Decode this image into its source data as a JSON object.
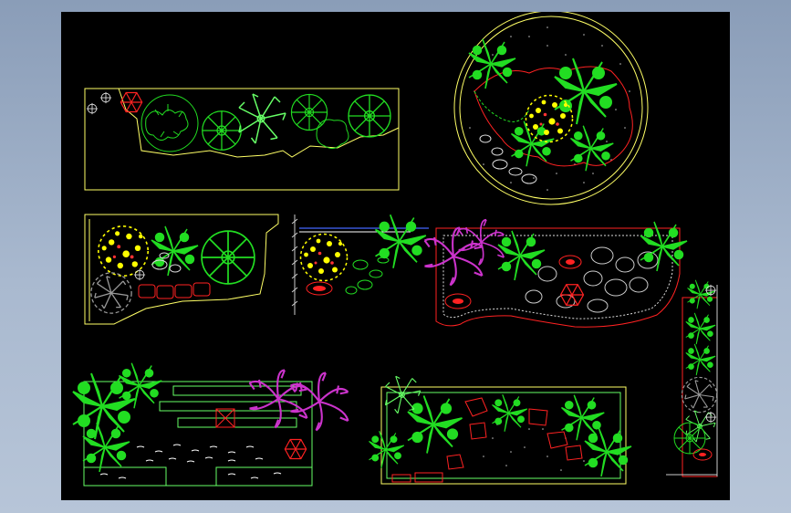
{
  "drawing": {
    "background": "#000000",
    "outer_background": "#9fb1c9",
    "palette": {
      "outline_yellow": "#ffff66",
      "paving_white": "#ffffff",
      "foliage_green": "#22dd22",
      "shrub_lightgreen": "#66ff66",
      "flower_yellow": "#ffff00",
      "ornamental_magenta": "#cc33cc",
      "edging_red": "#ff2222",
      "rock_gray": "#9a9a9a",
      "water_blue": "#4466ff"
    },
    "panels": [
      {
        "id": "linear-planter-top",
        "content": [
          "hexagon-lantern",
          "circle-trees",
          "ferns",
          "yellow-border"
        ]
      },
      {
        "id": "circular-garden",
        "content": [
          "palms",
          "flower-cluster",
          "gravel",
          "stepping-stones"
        ]
      },
      {
        "id": "corner-garden",
        "content": [
          "flower-shrub",
          "palm",
          "gray-shrub",
          "stone-path"
        ]
      },
      {
        "id": "wall-section",
        "content": [
          "flower-shrub",
          "fern",
          "pebbles",
          "water-line"
        ]
      },
      {
        "id": "curved-pavement",
        "content": [
          "magenta-palms",
          "rock-pond",
          "hexagon-lantern",
          "paving"
        ]
      },
      {
        "id": "vertical-strip",
        "content": [
          "climbing-plants",
          "gray-shrub",
          "lamp"
        ]
      },
      {
        "id": "deck-garden",
        "content": [
          "ferns",
          "magenta-palms",
          "deck-boards",
          "pebbles"
        ]
      },
      {
        "id": "gravel-court",
        "content": [
          "fern-cluster",
          "stepping-stones",
          "gravel",
          "palms"
        ]
      }
    ]
  }
}
